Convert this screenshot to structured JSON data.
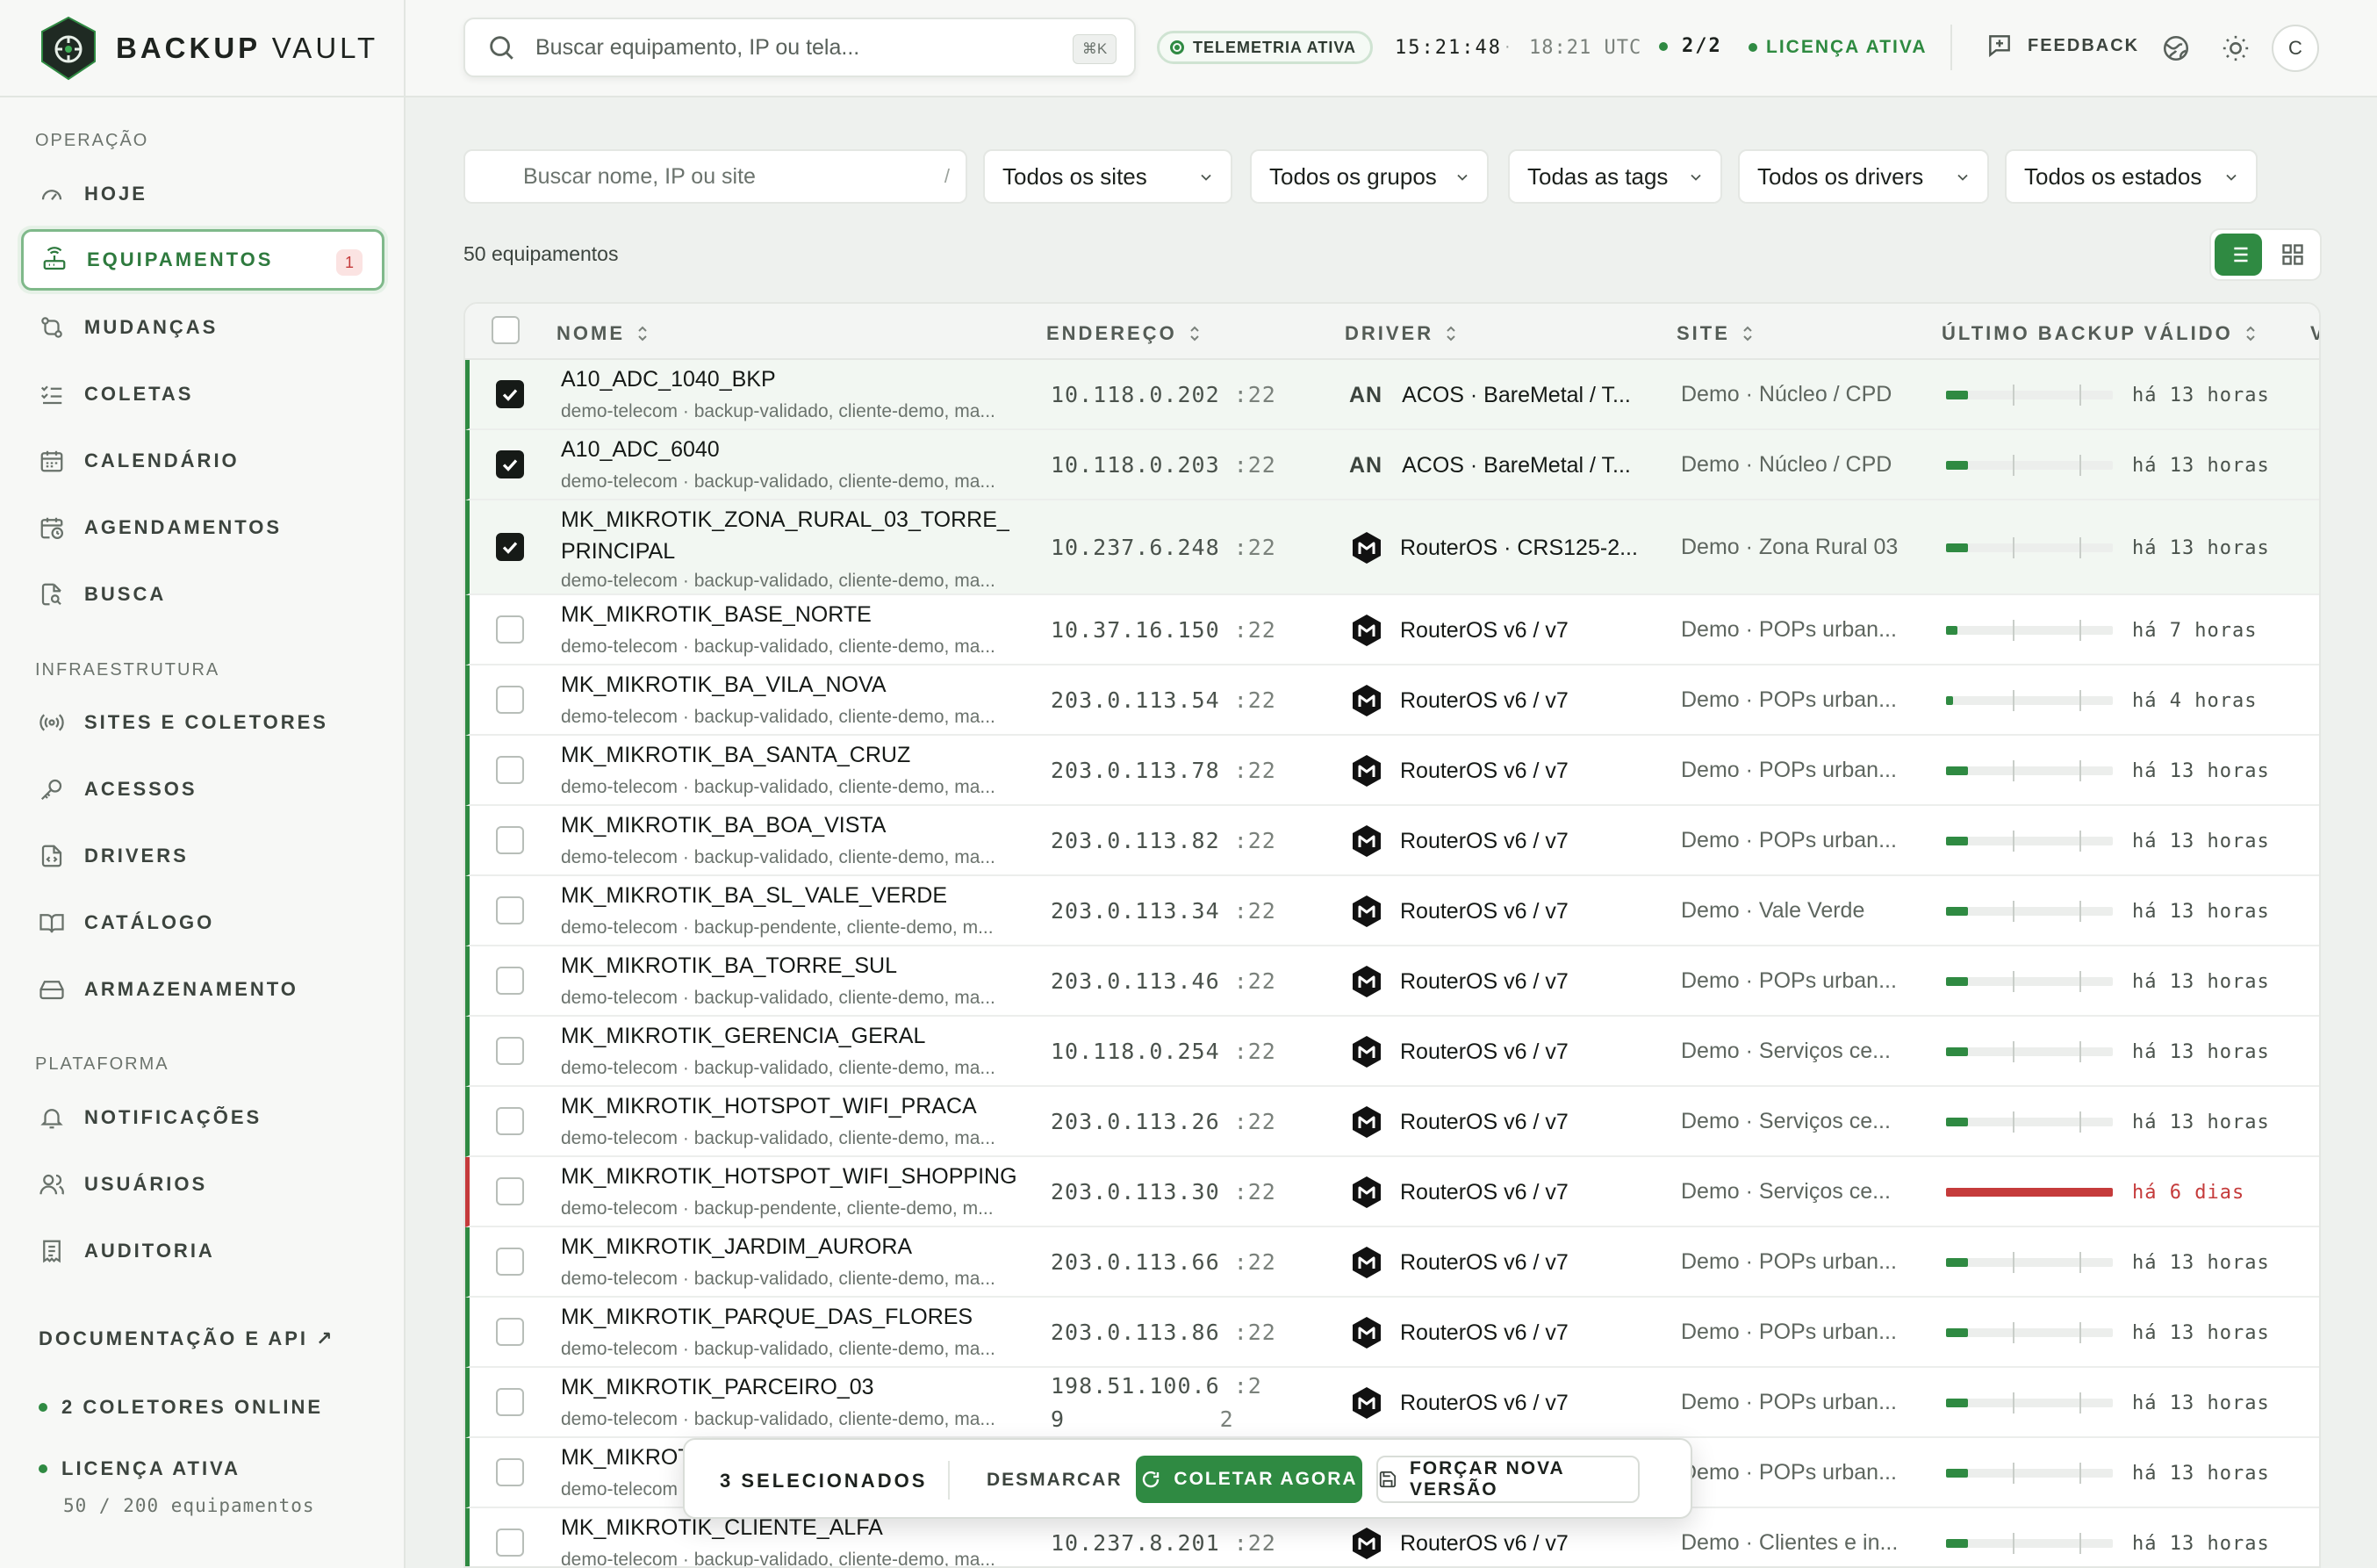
{
  "brand": {
    "name_bold": "BACKUP",
    "name_light": "VAULT"
  },
  "search": {
    "placeholder": "Buscar equipamento, IP ou tela...",
    "shortcut": "⌘K"
  },
  "topbar": {
    "telemetry": "TELEMETRIA ATIVA",
    "local_time": "15:21:48",
    "separator": "·",
    "utc_time": "18:21 UTC",
    "collectors": "2/2",
    "license": "LICENÇA ATIVA",
    "feedback": "FEEDBACK",
    "avatar_initial": "C"
  },
  "sidebar": {
    "sections": [
      "OPERAÇÃO",
      "INFRAESTRUTURA",
      "PLATAFORMA"
    ],
    "items": [
      {
        "label": "HOJE",
        "icon": "gauge-icon"
      },
      {
        "label": "EQUIPAMENTOS",
        "icon": "router-icon",
        "badge": "1",
        "active": true
      },
      {
        "label": "MUDANÇAS",
        "icon": "git-compare-icon"
      },
      {
        "label": "COLETAS",
        "icon": "list-check-icon"
      },
      {
        "label": "CALENDÁRIO",
        "icon": "calendar-icon"
      },
      {
        "label": "AGENDAMENTOS",
        "icon": "calendar-clock-icon"
      },
      {
        "label": "BUSCA",
        "icon": "file-search-icon"
      },
      {
        "label": "SITES E COLETORES",
        "icon": "radio-icon"
      },
      {
        "label": "ACESSOS",
        "icon": "key-icon"
      },
      {
        "label": "DRIVERS",
        "icon": "file-code-icon"
      },
      {
        "label": "CATÁLOGO",
        "icon": "book-icon"
      },
      {
        "label": "ARMAZENAMENTO",
        "icon": "hard-drive-icon"
      },
      {
        "label": "NOTIFICAÇÕES",
        "icon": "bell-icon"
      },
      {
        "label": "USUÁRIOS",
        "icon": "users-icon"
      },
      {
        "label": "AUDITORIA",
        "icon": "receipt-icon"
      }
    ],
    "docs_link": "DOCUMENTAÇÃO E API ↗",
    "collectors_online": "2 COLETORES ONLINE",
    "license": "LICENÇA ATIVA",
    "license_usage": "50 / 200 equipamentos"
  },
  "filters": {
    "search_placeholder": "Buscar nome, IP ou site",
    "search_shortcut": "/",
    "selects": [
      "Todos os sites",
      "Todos os grupos",
      "Todas as tags",
      "Todos os drivers",
      "Todos os estados"
    ]
  },
  "count_label": "50 equipamentos",
  "table": {
    "headers": {
      "name": "NOME",
      "address": "ENDEREÇO",
      "driver": "DRIVER",
      "site": "SITE",
      "backup": "ÚLTIMO BACKUP VÁLIDO",
      "next": "V"
    },
    "rows": [
      {
        "name": "A10_ADC_1040_BKP",
        "tags": "demo-telecom · backup-validado, cliente-demo, ma...",
        "ip": "10.118.0.202",
        "port": ":22",
        "driver_prefix": "AN",
        "driver": "ACOS · BareMetal / T...",
        "site": "Demo · Núcleo / CPD",
        "backup": "há 13 horas",
        "backup_fraction": 0.13,
        "checked": true,
        "state": "ok"
      },
      {
        "name": "A10_ADC_6040",
        "tags": "demo-telecom · backup-validado, cliente-demo, ma...",
        "ip": "10.118.0.203",
        "port": ":22",
        "driver_prefix": "AN",
        "driver": "ACOS · BareMetal / T...",
        "site": "Demo · Núcleo / CPD",
        "backup": "há 13 horas",
        "backup_fraction": 0.13,
        "checked": true,
        "state": "ok"
      },
      {
        "name": "MK_MIKROTIK_ZONA_RURAL_03_TORRE_",
        "name2": "PRINCIPAL",
        "tags": "demo-telecom · backup-validado, cliente-demo, ma...",
        "ip": "10.237.6.248",
        "port": ":22",
        "driver": "RouterOS · CRS125-2...",
        "site": "Demo · Zona Rural 03",
        "backup": "há 13 horas",
        "backup_fraction": 0.13,
        "checked": true,
        "state": "ok"
      },
      {
        "name": "MK_MIKROTIK_BASE_NORTE",
        "tags": "demo-telecom · backup-validado, cliente-demo, ma...",
        "ip": "10.37.16.150",
        "port": ":22",
        "driver": "RouterOS v6 / v7",
        "site": "Demo · POPs urban...",
        "backup": "há 7 horas",
        "backup_fraction": 0.07,
        "checked": false,
        "state": "ok"
      },
      {
        "name": "MK_MIKROTIK_BA_VILA_NOVA",
        "tags": "demo-telecom · backup-validado, cliente-demo, ma...",
        "ip": "203.0.113.54",
        "port": ":22",
        "driver": "RouterOS v6 / v7",
        "site": "Demo · POPs urban...",
        "backup": "há 4 horas",
        "backup_fraction": 0.04,
        "checked": false,
        "state": "ok"
      },
      {
        "name": "MK_MIKROTIK_BA_SANTA_CRUZ",
        "tags": "demo-telecom · backup-validado, cliente-demo, ma...",
        "ip": "203.0.113.78",
        "port": ":22",
        "driver": "RouterOS v6 / v7",
        "site": "Demo · POPs urban...",
        "backup": "há 13 horas",
        "backup_fraction": 0.13,
        "checked": false,
        "state": "ok"
      },
      {
        "name": "MK_MIKROTIK_BA_BOA_VISTA",
        "tags": "demo-telecom · backup-validado, cliente-demo, ma...",
        "ip": "203.0.113.82",
        "port": ":22",
        "driver": "RouterOS v6 / v7",
        "site": "Demo · POPs urban...",
        "backup": "há 13 horas",
        "backup_fraction": 0.13,
        "checked": false,
        "state": "ok"
      },
      {
        "name": "MK_MIKROTIK_BA_SL_VALE_VERDE",
        "tags": "demo-telecom · backup-pendente, cliente-demo, m...",
        "ip": "203.0.113.34",
        "port": ":22",
        "driver": "RouterOS v6 / v7",
        "site": "Demo · Vale Verde",
        "backup": "há 13 horas",
        "backup_fraction": 0.13,
        "checked": false,
        "state": "ok"
      },
      {
        "name": "MK_MIKROTIK_BA_TORRE_SUL",
        "tags": "demo-telecom · backup-validado, cliente-demo, ma...",
        "ip": "203.0.113.46",
        "port": ":22",
        "driver": "RouterOS v6 / v7",
        "site": "Demo · POPs urban...",
        "backup": "há 13 horas",
        "backup_fraction": 0.13,
        "checked": false,
        "state": "ok"
      },
      {
        "name": "MK_MIKROTIK_GERENCIA_GERAL",
        "tags": "demo-telecom · backup-validado, cliente-demo, ma...",
        "ip": "10.118.0.254",
        "port": ":22",
        "driver": "RouterOS v6 / v7",
        "site": "Demo · Serviços ce...",
        "backup": "há 13 horas",
        "backup_fraction": 0.13,
        "checked": false,
        "state": "ok"
      },
      {
        "name": "MK_MIKROTIK_HOTSPOT_WIFI_PRACA",
        "tags": "demo-telecom · backup-validado, cliente-demo, ma...",
        "ip": "203.0.113.26",
        "port": ":22",
        "driver": "RouterOS v6 / v7",
        "site": "Demo · Serviços ce...",
        "backup": "há 13 horas",
        "backup_fraction": 0.13,
        "checked": false,
        "state": "ok"
      },
      {
        "name": "MK_MIKROTIK_HOTSPOT_WIFI_SHOPPING",
        "tags": "demo-telecom · backup-pendente, cliente-demo, m...",
        "ip": "203.0.113.30",
        "port": ":22",
        "driver": "RouterOS v6 / v7",
        "site": "Demo · Serviços ce...",
        "backup": "há 6 dias",
        "backup_fraction": 1.0,
        "checked": false,
        "state": "error"
      },
      {
        "name": "MK_MIKROTIK_JARDIM_AURORA",
        "tags": "demo-telecom · backup-validado, cliente-demo, ma...",
        "ip": "203.0.113.66",
        "port": ":22",
        "driver": "RouterOS v6 / v7",
        "site": "Demo · POPs urban...",
        "backup": "há 13 horas",
        "backup_fraction": 0.13,
        "checked": false,
        "state": "ok"
      },
      {
        "name": "MK_MIKROTIK_PARQUE_DAS_FLORES",
        "tags": "demo-telecom · backup-validado, cliente-demo, ma...",
        "ip": "203.0.113.86",
        "port": ":22",
        "driver": "RouterOS v6 / v7",
        "site": "Demo · POPs urban...",
        "backup": "há 13 horas",
        "backup_fraction": 0.13,
        "checked": false,
        "state": "ok"
      },
      {
        "name": "MK_MIKROTIK_PARCEIRO_03",
        "tags": "demo-telecom · backup-validado, cliente-demo, ma...",
        "ip": "198.51.100.6",
        "ip2": "9",
        "port": ":2",
        "port2": "2",
        "driver": "RouterOS v6 / v7",
        "site": "Demo · POPs urban...",
        "backup": "há 13 horas",
        "backup_fraction": 0.13,
        "checked": false,
        "state": "ok"
      },
      {
        "name": "MK_MIKROT",
        "tags": "demo-telecom",
        "ip": "",
        "port": "",
        "driver": "",
        "site": "Demo · POPs urban...",
        "backup": "há 13 horas",
        "backup_fraction": 0.13,
        "checked": false,
        "state": "ok"
      },
      {
        "name": "MK_MIKROTIK_CLIENTE_ALFA",
        "tags": "demo-telecom · backup-validado, cliente-demo, ma...",
        "ip": "10.237.8.201",
        "port": ":22",
        "driver": "RouterOS v6 / v7",
        "site": "Demo · Clientes e in...",
        "backup": "há 13 horas",
        "backup_fraction": 0.13,
        "checked": false,
        "state": "ok"
      }
    ]
  },
  "bulk": {
    "count": "3 SELECIONADOS",
    "unselect": "DESMARCAR",
    "collect": "COLETAR AGORA",
    "force": "FORÇAR NOVA VERSÃO"
  },
  "colors": {
    "accent": "#2f8a42",
    "error": "#c53b3b"
  }
}
